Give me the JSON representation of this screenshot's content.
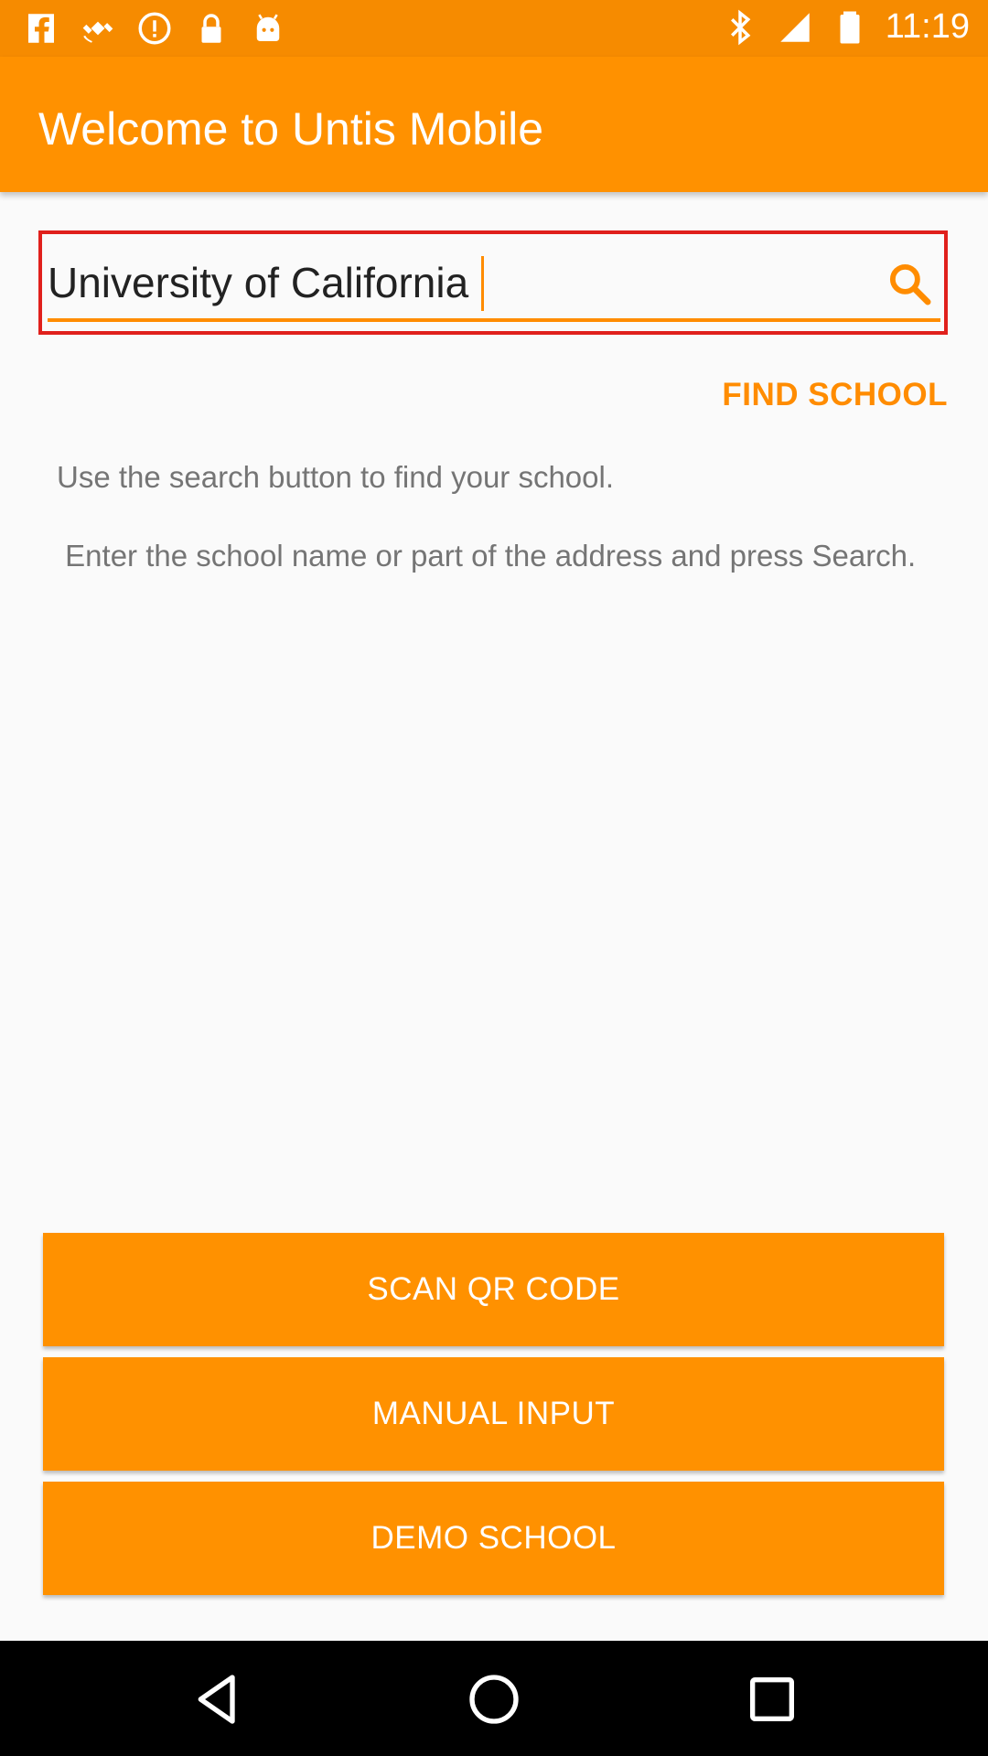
{
  "status_bar": {
    "time": "11:19",
    "left_icons": [
      "facebook-icon",
      "fake-gps-icon",
      "alert-icon",
      "lock-icon",
      "android-icon"
    ],
    "right_icons": [
      "bluetooth-icon",
      "signal-icon",
      "battery-icon"
    ]
  },
  "app_bar": {
    "title": "Welcome to Untis Mobile"
  },
  "search": {
    "value": "University of California",
    "icon": "search-icon"
  },
  "find_school_label": "FIND SCHOOL",
  "help": {
    "line1": "Use the search button to find your school.",
    "line2": " Enter the school name or part of the address and press Search."
  },
  "buttons": {
    "scan": "SCAN QR CODE",
    "manual": "MANUAL INPUT",
    "demo": "DEMO SCHOOL"
  },
  "colors": {
    "primary": "#ff9100",
    "status_bar": "#f68b00",
    "highlight": "#e0201c"
  }
}
